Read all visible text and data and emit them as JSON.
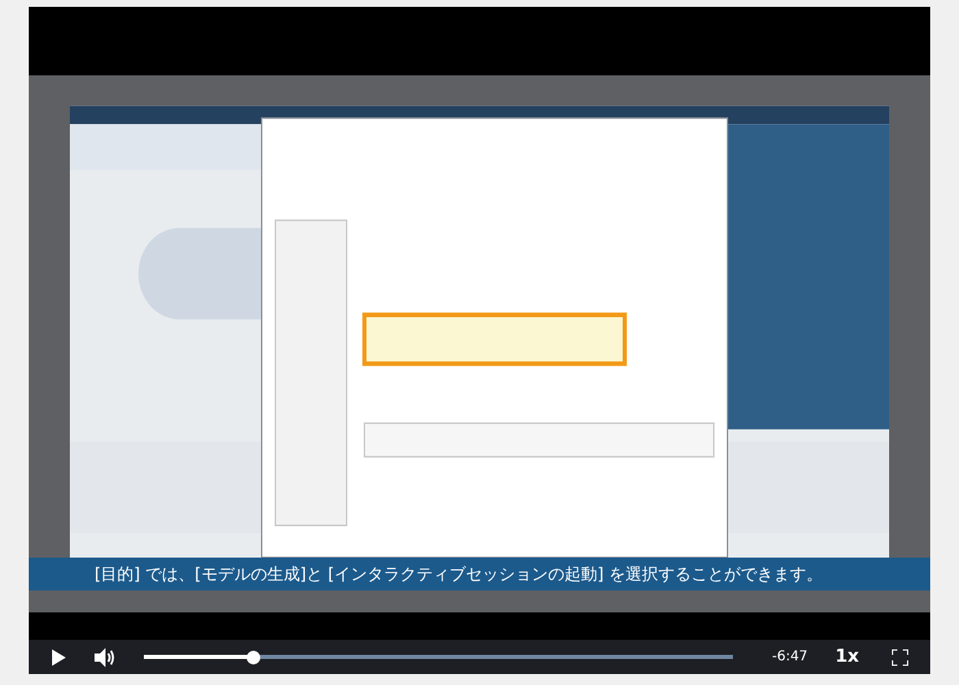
{
  "caption": "[目的] では、[モデルの生成]と [インタラクティブセッションの起動] を選択することができます。",
  "controls": {
    "progress": {
      "level": 0.185
    },
    "remaining": "-6:47",
    "speed": "1x"
  }
}
